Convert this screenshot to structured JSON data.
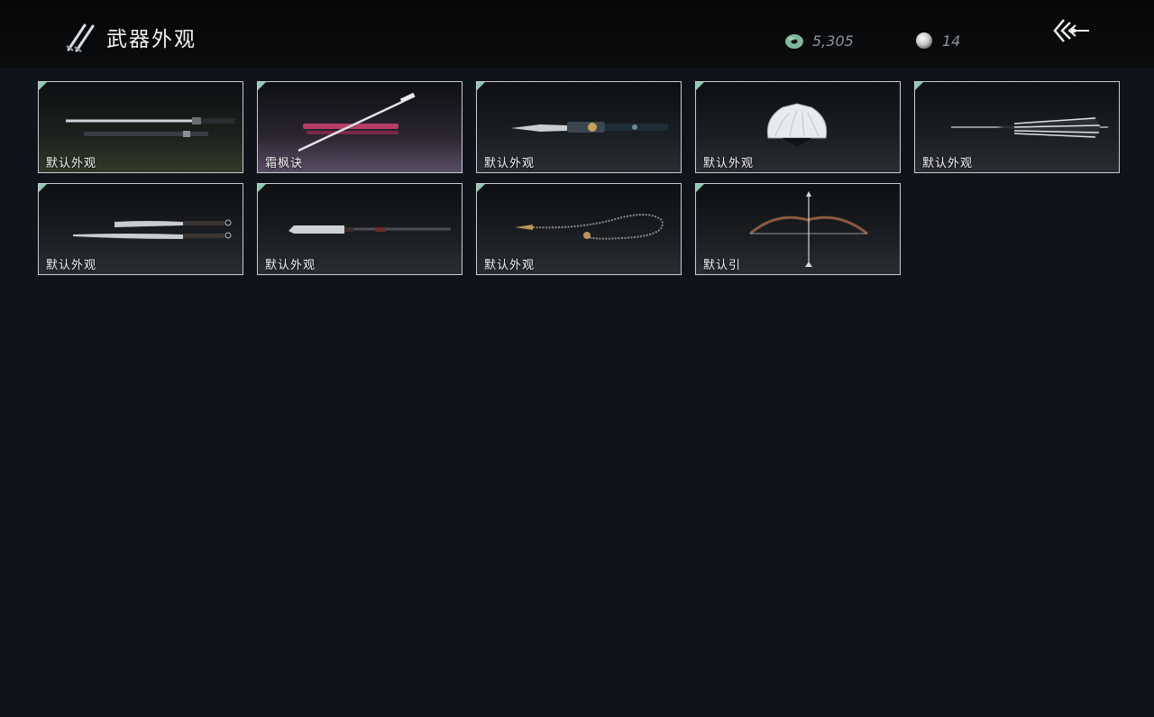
{
  "header": {
    "title": "武器外观",
    "title_icon": "twin-blades-icon",
    "back_icon": "back-arrow-icon"
  },
  "currency": {
    "jade": {
      "icon": "jade-coin-icon",
      "value": "5,305"
    },
    "pearl": {
      "icon": "pearl-icon",
      "value": "14"
    }
  },
  "colors": {
    "background": "#0f131a",
    "card_border": "#c7cdd2",
    "corner_accent": "#8fc9b0"
  },
  "weapons": [
    {
      "label": "默认外观",
      "icon": "sword-and-scabbard-icon"
    },
    {
      "label": "霜枫诀",
      "icon": "frost-maple-sword-icon"
    },
    {
      "label": "默认外观",
      "icon": "ornate-dagger-icon"
    },
    {
      "label": "默认外观",
      "icon": "folding-fan-icon"
    },
    {
      "label": "默认外观",
      "icon": "umbrella-icon"
    },
    {
      "label": "默认外观",
      "icon": "dual-sabres-icon"
    },
    {
      "label": "默认外观",
      "icon": "glaive-spear-icon"
    },
    {
      "label": "默认外观",
      "icon": "rope-dart-icon"
    },
    {
      "label": "默认引",
      "icon": "bow-and-arrow-icon"
    }
  ]
}
